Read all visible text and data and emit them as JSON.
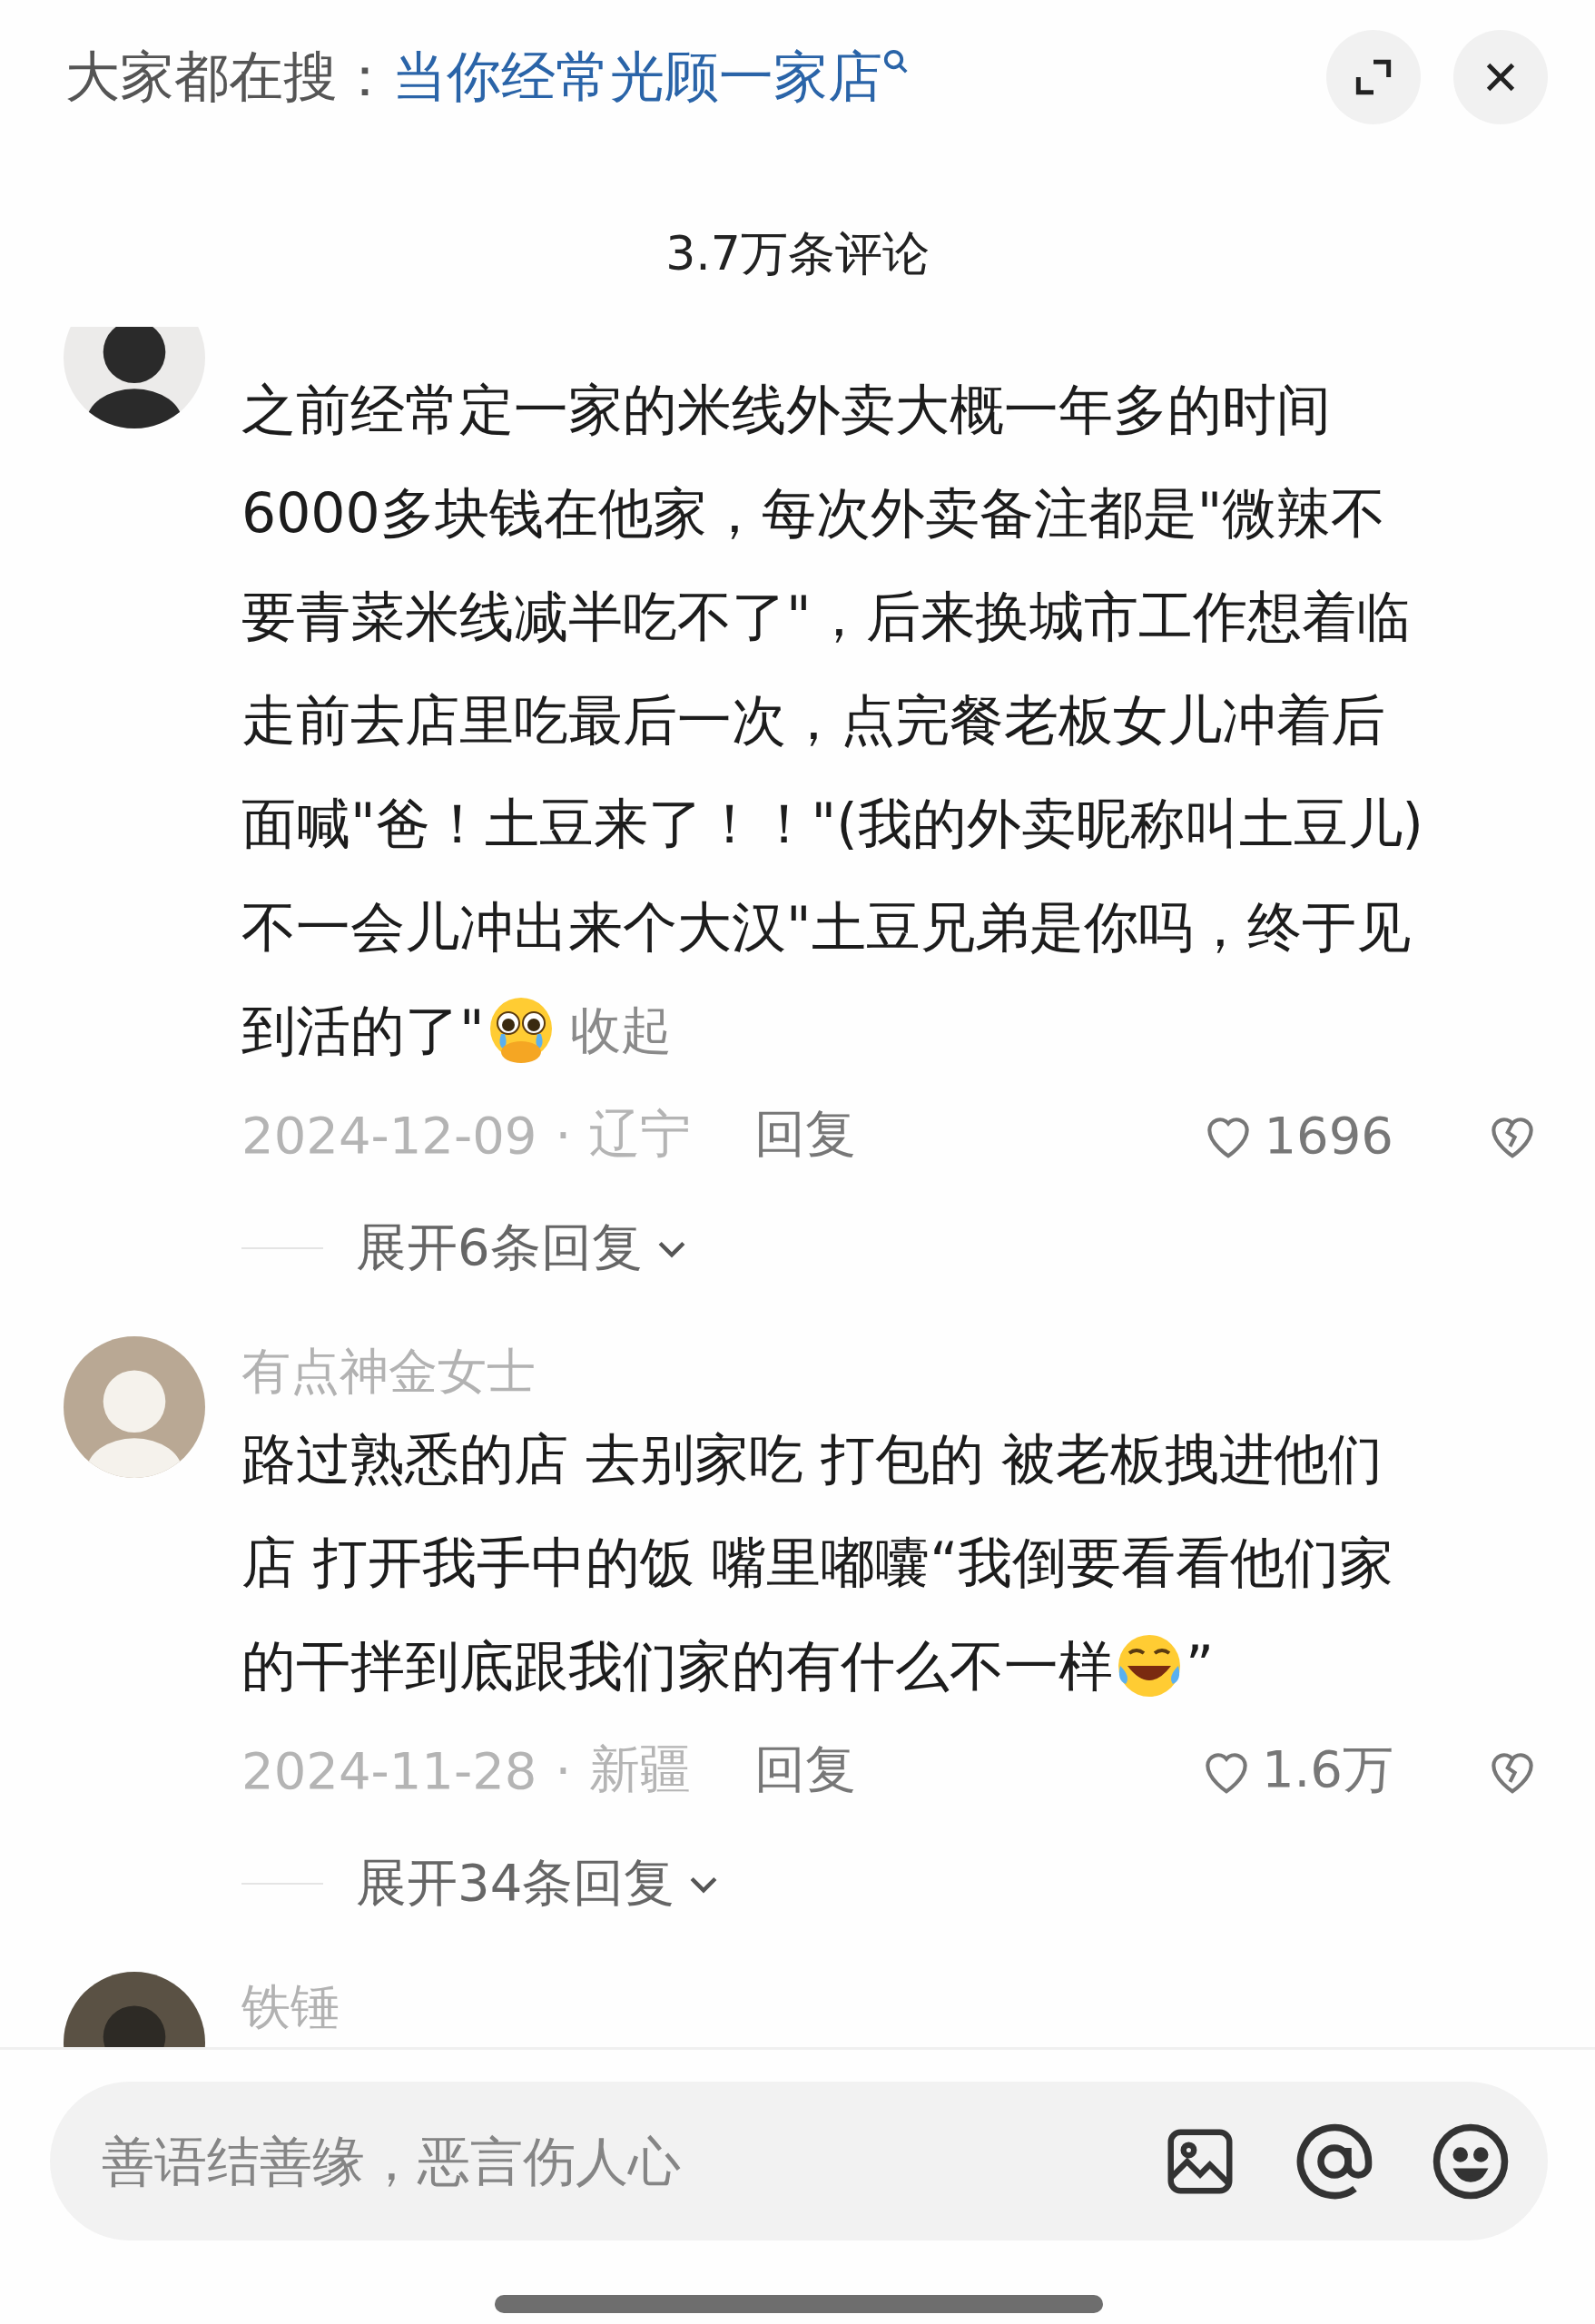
{
  "header": {
    "prefix": "大家都在搜：",
    "query": "当你经常光顾一家店"
  },
  "comment_count": "3.7万条评论",
  "comments": [
    {
      "lines": [
        [
          {
            "kind": "text",
            "text": "之前经常定一家的米线外卖大概一年多的时间"
          }
        ],
        [
          {
            "kind": "text",
            "text": "6000多块钱在他家，每次外卖备注都是\"微辣不"
          }
        ],
        [
          {
            "kind": "text",
            "text": "要青菜米线减半吃不了\"，后来换城市工作想着临"
          }
        ],
        [
          {
            "kind": "text",
            "text": "走前去店里吃最后一次，点完餐老板女儿冲着后"
          }
        ],
        [
          {
            "kind": "text",
            "text": "面喊\"爸！土豆来了！！\"(我的外卖昵称叫土豆儿)"
          }
        ],
        [
          {
            "kind": "text",
            "text": "不一会儿冲出来个大汉\"土豆兄弟是你吗，终于见"
          }
        ],
        [
          {
            "kind": "text",
            "text": "到活的了\""
          },
          {
            "kind": "emoji"
          },
          {
            "kind": "link",
            "text": "收起"
          }
        ]
      ],
      "date": "2024-12-09",
      "separator": "·",
      "region": "辽宁",
      "reply": "回复",
      "likes": "1696",
      "expand": "展开6条回复"
    },
    {
      "name": "有点神金女士",
      "lines": [
        [
          {
            "kind": "text",
            "text": "路过熟悉的店 去别家吃 打包的 被老板拽进他们"
          }
        ],
        [
          {
            "kind": "text",
            "text": "店 打开我手中的饭 嘴里嘟囔“我倒要看看他们家"
          }
        ],
        [
          {
            "kind": "text",
            "text": "的干拌到底跟我们家的有什么不一样"
          },
          {
            "kind": "emoji"
          },
          {
            "kind": "text",
            "text": "”"
          }
        ]
      ],
      "date": "2024-11-28",
      "separator": "·",
      "region": "新疆",
      "reply": "回复",
      "likes": "1.6万",
      "expand": "展开34条回复"
    },
    {
      "name": "铁锤"
    }
  ],
  "composer": {
    "placeholder": "善语结善缘，恶言伤人心"
  }
}
